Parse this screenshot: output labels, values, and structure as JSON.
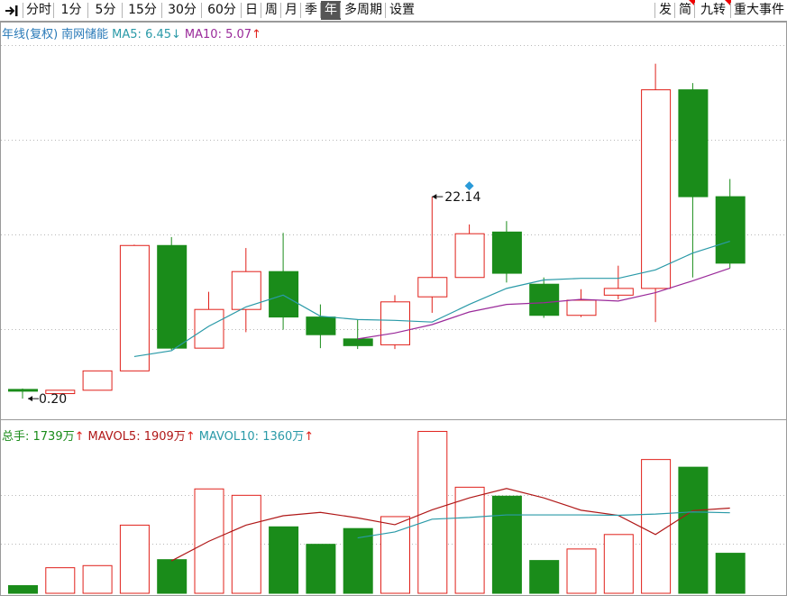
{
  "toolbar": {
    "left_items": [
      {
        "label": "分时",
        "name": "tab-minute"
      },
      {
        "label": "1分",
        "name": "tab-1min"
      },
      {
        "label": "5分",
        "name": "tab-5min"
      },
      {
        "label": "15分",
        "name": "tab-15min"
      },
      {
        "label": "30分",
        "name": "tab-30min"
      },
      {
        "label": "60分",
        "name": "tab-60min"
      },
      {
        "label": "日",
        "name": "tab-day"
      },
      {
        "label": "周",
        "name": "tab-week"
      },
      {
        "label": "月",
        "name": "tab-month"
      },
      {
        "label": "季",
        "name": "tab-quarter"
      },
      {
        "label": "年",
        "name": "tab-year",
        "active": true
      },
      {
        "label": "多周期",
        "name": "tab-multi-period"
      },
      {
        "label": "设置",
        "name": "tab-settings"
      }
    ],
    "right_items": [
      {
        "label": "发",
        "name": "tab-fa"
      },
      {
        "label": "简",
        "name": "tab-jian"
      },
      {
        "label": "九转",
        "name": "tab-nine-turn"
      },
      {
        "label": "重大事件",
        "name": "tab-major-events"
      }
    ],
    "collapse_icon": "collapse-arrow-icon"
  },
  "price_legend": {
    "period_label": "年线(复权)",
    "stock_name": "南网储能",
    "ma5_label": "MA5: 6.45",
    "ma5_arrow": "↓",
    "ma10_label": "MA10: 5.07",
    "ma10_arrow": "↑"
  },
  "volume_legend": {
    "total_label": "总手: 1739万",
    "total_arrow": "↑",
    "mavol5_label": "MAVOL5: 1909万",
    "mavol5_arrow": "↑",
    "mavol10_label": "MAVOL10: 1360万",
    "mavol10_arrow": "↑"
  },
  "colors": {
    "up": "#e0201a",
    "down": "#1a8c1a",
    "ma5": "#2a9aa8",
    "ma10": "#9a2a9a",
    "mavol5": "#b01818",
    "mavol10": "#2a9aa8",
    "legend_name": "#2a7ab8",
    "marker": "#2a9ad8"
  },
  "chart_data": {
    "type": "candlestick",
    "annotations": {
      "high_label": "22.14",
      "low_label": "0.20"
    },
    "candles": [
      {
        "open": 1.3,
        "close": 1.1,
        "high": 1.4,
        "low": 0.2,
        "volume": 180
      },
      {
        "open": 0.8,
        "close": 1.2,
        "high": 1.2,
        "low": 0.7,
        "volume": 600
      },
      {
        "open": 1.2,
        "close": 3.5,
        "high": 3.5,
        "low": 1.2,
        "volume": 650
      },
      {
        "open": 3.5,
        "close": 18.4,
        "high": 18.5,
        "low": 3.5,
        "volume": 1600
      },
      {
        "open": 18.4,
        "close": 6.2,
        "high": 19.4,
        "low": 6.0,
        "volume": 790
      },
      {
        "open": 6.2,
        "close": 10.8,
        "high": 12.9,
        "low": 6.2,
        "volume": 2450
      },
      {
        "open": 10.8,
        "close": 15.3,
        "high": 18.1,
        "low": 8.1,
        "volume": 2300
      },
      {
        "open": 15.3,
        "close": 9.9,
        "high": 19.9,
        "low": 8.4,
        "volume": 1560
      },
      {
        "open": 9.9,
        "close": 7.8,
        "high": 11.4,
        "low": 6.2,
        "volume": 1150
      },
      {
        "open": 7.3,
        "close": 6.5,
        "high": 9.6,
        "low": 6.1,
        "volume": 1520
      },
      {
        "open": 6.6,
        "close": 11.7,
        "high": 12.5,
        "low": 6.1,
        "volume": 1800
      },
      {
        "open": 12.3,
        "close": 14.6,
        "high": 24.2,
        "low": 10.4,
        "volume": 3800
      },
      {
        "open": 14.6,
        "close": 19.8,
        "high": 20.9,
        "low": 14.6,
        "volume": 2490
      },
      {
        "open": 20.0,
        "close": 15.1,
        "high": 21.3,
        "low": 14.0,
        "volume": 2280
      },
      {
        "open": 13.8,
        "close": 10.1,
        "high": 14.6,
        "low": 9.8,
        "volume": 770
      },
      {
        "open": 10.1,
        "close": 11.9,
        "high": 13.2,
        "low": 9.9,
        "volume": 1040
      },
      {
        "open": 12.5,
        "close": 13.3,
        "high": 16.0,
        "low": 12.0,
        "volume": 1380
      },
      {
        "open": 13.3,
        "close": 36.9,
        "high": 40.0,
        "low": 9.3,
        "volume": 3140
      },
      {
        "open": 36.9,
        "close": 24.2,
        "high": 37.7,
        "low": 14.6,
        "volume": 2960
      },
      {
        "open": 24.2,
        "close": 16.3,
        "high": 26.3,
        "low": 15.7,
        "volume": 940
      }
    ],
    "ma5": [
      null,
      null,
      null,
      5.2,
      5.9,
      8.8,
      11.1,
      12.5,
      10.0,
      9.6,
      9.5,
      9.3,
      11.4,
      13.3,
      14.3,
      14.5,
      14.5,
      15.5,
      17.5,
      18.9
    ],
    "ma10": [
      null,
      null,
      null,
      null,
      null,
      null,
      null,
      null,
      null,
      7.3,
      8.0,
      9.0,
      10.5,
      11.4,
      11.6,
      12.0,
      11.8,
      12.8,
      14.2,
      15.7
    ],
    "mavol5": [
      null,
      null,
      null,
      null,
      760,
      1220,
      1600,
      1820,
      1900,
      1770,
      1610,
      1960,
      2240,
      2460,
      2240,
      1950,
      1830,
      1380,
      1940,
      2000
    ],
    "mavol10": [
      null,
      null,
      null,
      null,
      null,
      null,
      null,
      null,
      null,
      1300,
      1440,
      1740,
      1780,
      1840,
      1840,
      1840,
      1830,
      1860,
      1910,
      1890
    ]
  }
}
